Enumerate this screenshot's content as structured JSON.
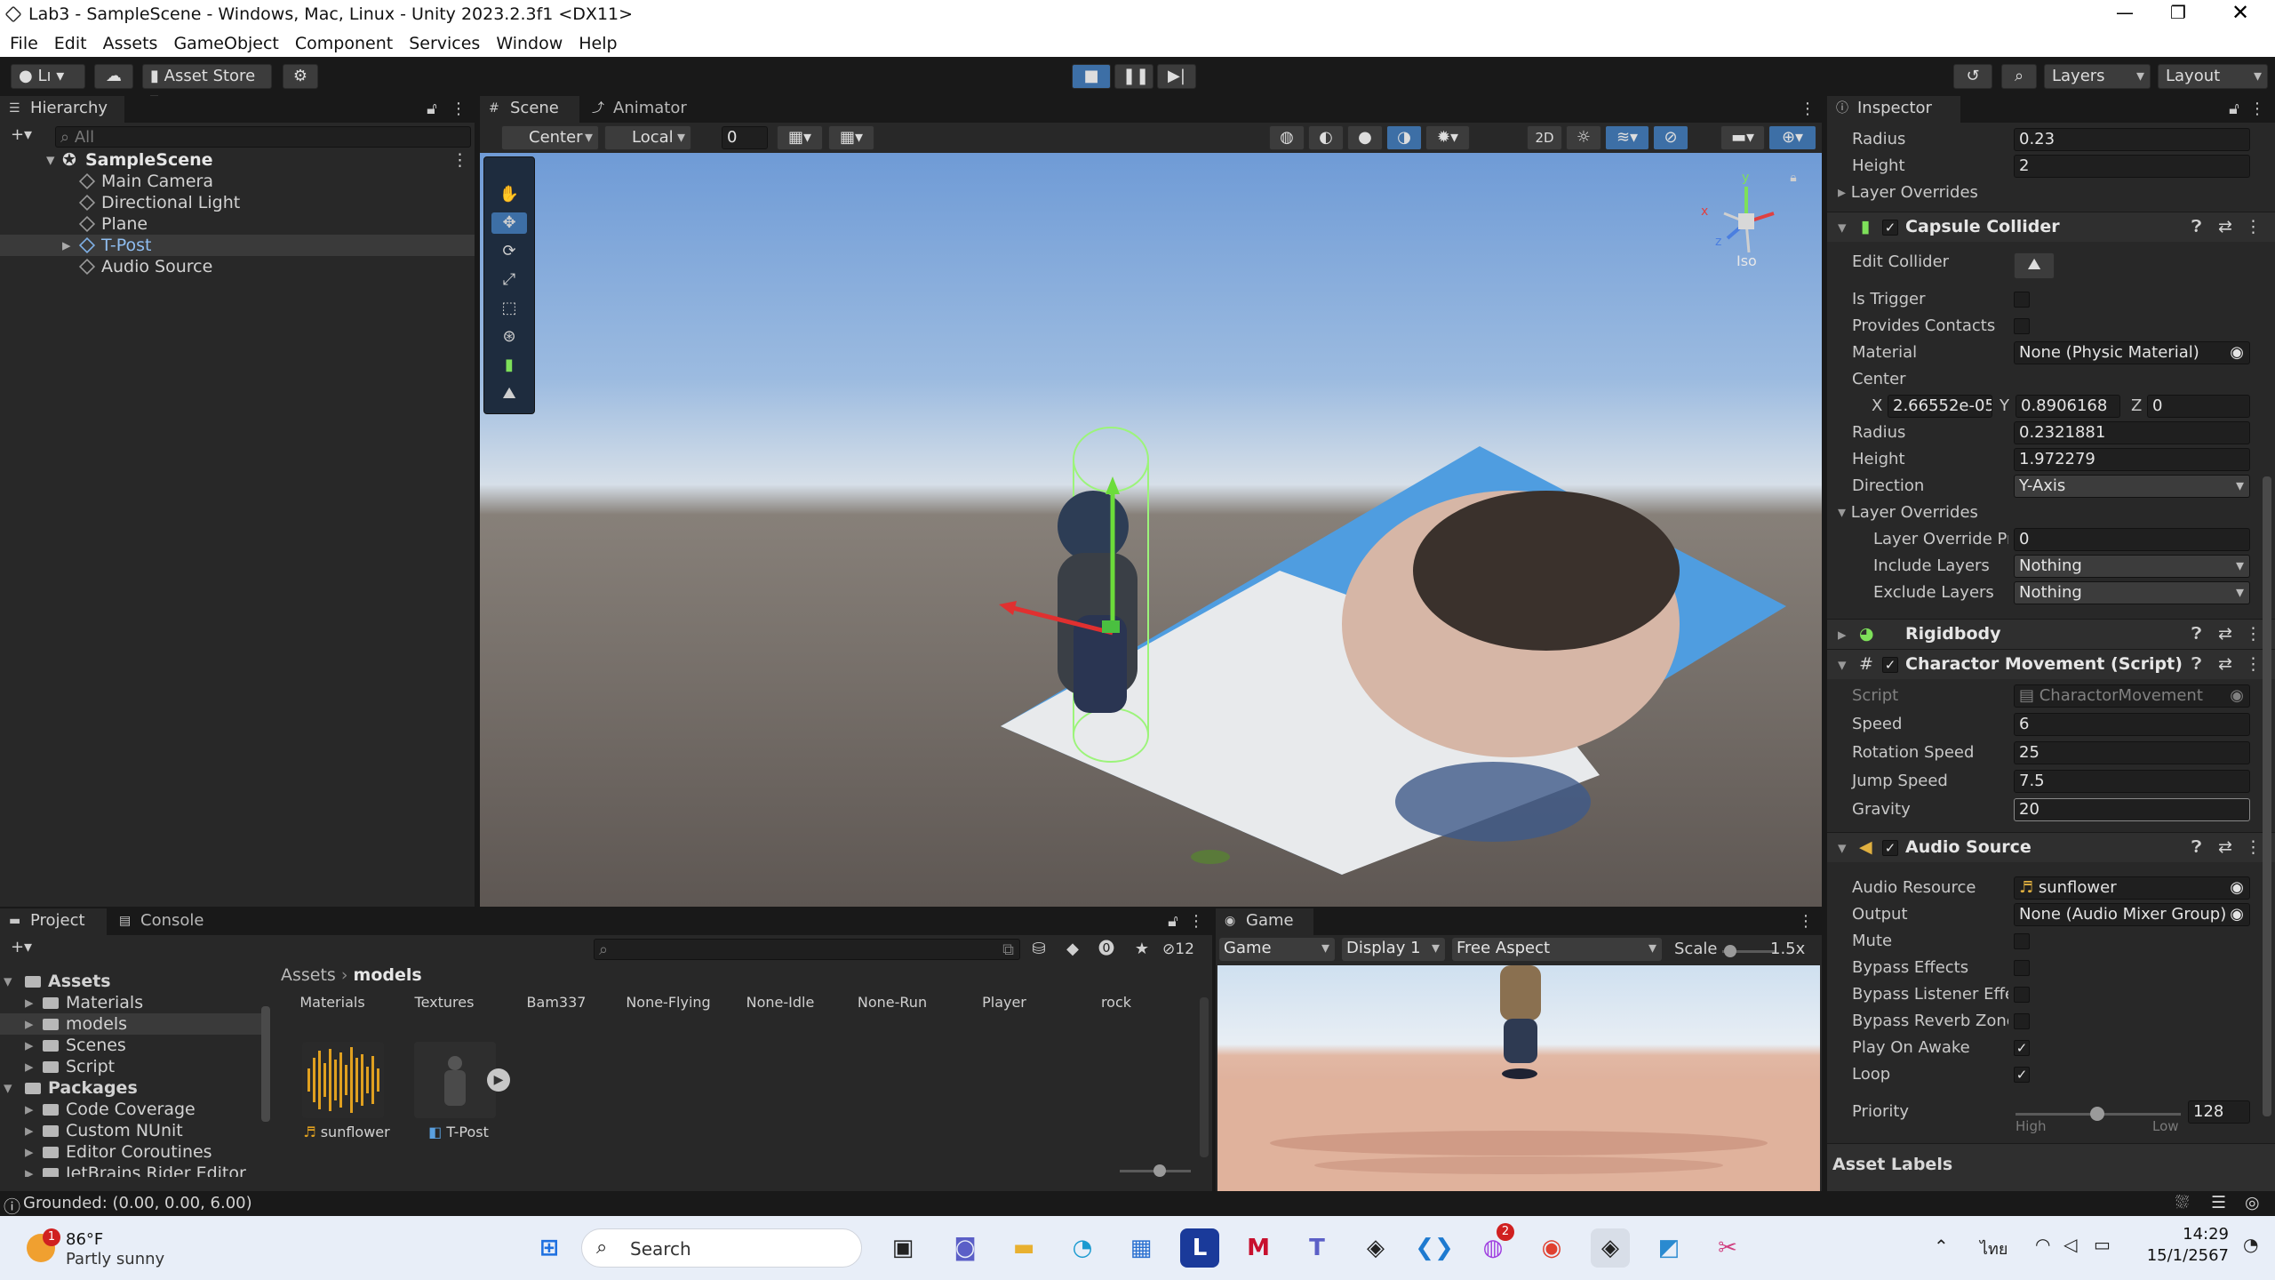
{
  "window": {
    "title": "Lab3 - SampleScene - Windows, Mac, Linux - Unity 2023.2.3f1 <DX11>"
  },
  "menu": [
    "File",
    "Edit",
    "Assets",
    "GameObject",
    "Component",
    "Services",
    "Window",
    "Help"
  ],
  "toolbar": {
    "account": "Lı",
    "asset_store": "Asset Store",
    "layers": "Layers",
    "layout": "Layout"
  },
  "hierarchy": {
    "tab": "Hierarchy",
    "search_placeholder": "All",
    "scene": "SampleScene",
    "items": [
      "Main Camera",
      "Directional Light",
      "Plane",
      "T-Post",
      "Audio Source"
    ]
  },
  "scene": {
    "tabs": [
      "Scene",
      "Animator"
    ],
    "pivot": "Center",
    "space": "Local",
    "snap_value": "0",
    "mode2d": "2D",
    "persp_label": "Iso"
  },
  "inspector": {
    "tab": "Inspector",
    "top_fields": [
      {
        "label": "Radius",
        "value": "0.23"
      },
      {
        "label": "Height",
        "value": "2"
      }
    ],
    "layer_overrides_collapsed": "Layer Overrides",
    "capsule": {
      "title": "Capsule Collider",
      "edit_collider": "Edit Collider",
      "is_trigger": "Is Trigger",
      "provides_contacts": "Provides Contacts",
      "material_label": "Material",
      "material": "None (Physic Material)",
      "center_label": "Center",
      "cx": "2.66552e-05",
      "cy": "0.8906168",
      "cz": "0",
      "radius_label": "Radius",
      "radius": "0.2321881",
      "height_label": "Height",
      "height": "1.972279",
      "direction_label": "Direction",
      "direction": "Y-Axis",
      "layer_overrides": "Layer Overrides",
      "layer_override_priority_label": "Layer Override Priority",
      "layer_override_priority": "0",
      "include_layers_label": "Include Layers",
      "include_layers": "Nothing",
      "exclude_layers_label": "Exclude Layers",
      "exclude_layers": "Nothing"
    },
    "rigidbody": {
      "title": "Rigidbody"
    },
    "movement": {
      "title": "Charactor Movement (Script)",
      "script_label": "Script",
      "script": "CharactorMovement",
      "speed_label": "Speed",
      "speed": "6",
      "rotation_speed_label": "Rotation Speed",
      "rotation_speed": "25",
      "jump_speed_label": "Jump Speed",
      "jump_speed": "7.5",
      "gravity_label": "Gravity",
      "gravity": "20"
    },
    "audio": {
      "title": "Audio Source",
      "resource_label": "Audio Resource",
      "resource": "sunflower",
      "output_label": "Output",
      "output": "None (Audio Mixer Group)",
      "mute": "Mute",
      "bypass_effects": "Bypass Effects",
      "bypass_listener": "Bypass Listener Effects",
      "bypass_reverb": "Bypass Reverb Zones",
      "play_on_awake": "Play On Awake",
      "loop": "Loop",
      "priority_label": "Priority",
      "priority": "128",
      "priority_high": "High",
      "priority_low": "Low"
    },
    "asset_labels": "Asset Labels"
  },
  "project": {
    "tabs": [
      "Project",
      "Console"
    ],
    "hidden_count": "12",
    "breadcrumb": [
      "Assets",
      "models"
    ],
    "tree": [
      {
        "label": "Assets",
        "bold": true,
        "depth": 0
      },
      {
        "label": "Materials",
        "depth": 1
      },
      {
        "label": "models",
        "depth": 1
      },
      {
        "label": "Scenes",
        "depth": 1
      },
      {
        "label": "Script",
        "depth": 1
      },
      {
        "label": "Packages",
        "bold": true,
        "depth": 0
      },
      {
        "label": "Code Coverage",
        "depth": 1
      },
      {
        "label": "Custom NUnit",
        "depth": 1
      },
      {
        "label": "Editor Coroutines",
        "depth": 1
      },
      {
        "label": "JetBrains Rider Editor",
        "depth": 1
      }
    ],
    "top_row": [
      "Materials",
      "Textures",
      "Bam337",
      "None-Flying",
      "None-Idle",
      "None-Run",
      "Player",
      "rock"
    ],
    "assets": [
      "sunflower",
      "T-Post"
    ]
  },
  "game": {
    "tab": "Game",
    "mode": "Game",
    "display": "Display 1",
    "aspect": "Free Aspect",
    "scale_label": "Scale",
    "scale": "1.5x"
  },
  "status": {
    "text": "Grounded: (0.00, 0.00, 6.00)"
  },
  "taskbar": {
    "weather_temp": "86°F",
    "weather_desc": "Partly sunny",
    "weather_badge": "1",
    "search": "Search",
    "messenger_badge": "2",
    "lang": "ไทย",
    "time": "14:29",
    "date": "15/1/2567"
  },
  "colors": {
    "accent": "#3a79bb",
    "panel": "#282828",
    "dark": "#191919",
    "selected": "#2c5d87"
  }
}
